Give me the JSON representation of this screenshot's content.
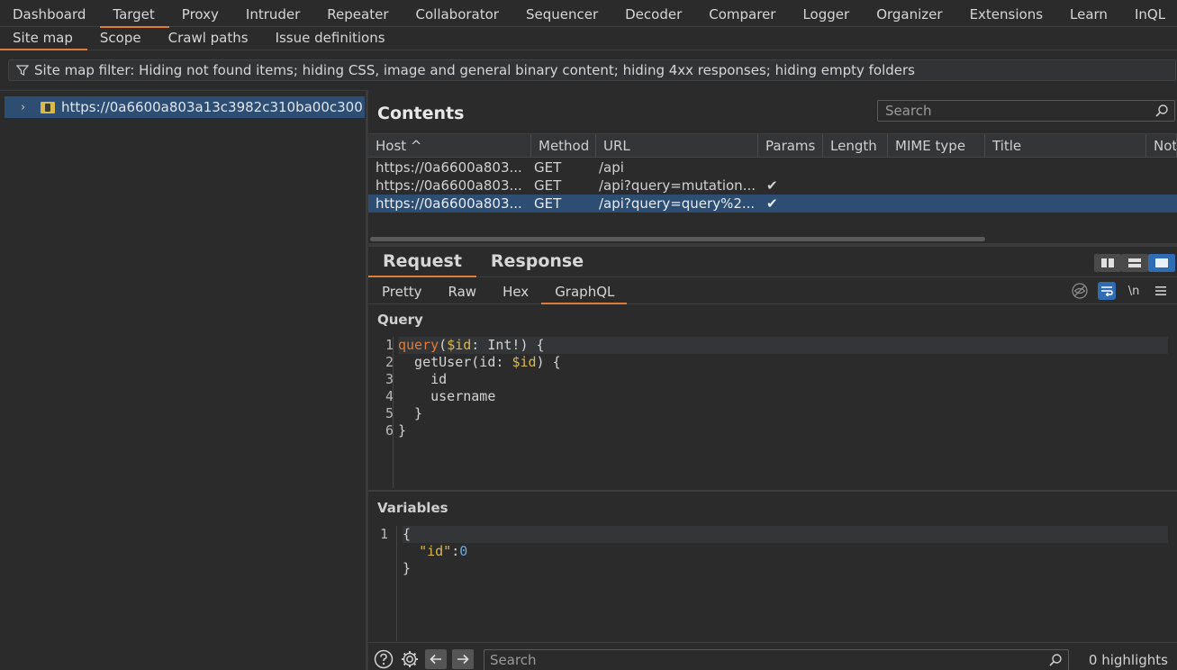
{
  "topnav": [
    "Dashboard",
    "Target",
    "Proxy",
    "Intruder",
    "Repeater",
    "Collaborator",
    "Sequencer",
    "Decoder",
    "Comparer",
    "Logger",
    "Organizer",
    "Extensions",
    "Learn",
    "InQL"
  ],
  "subnav": [
    "Site map",
    "Scope",
    "Crawl paths",
    "Issue definitions"
  ],
  "filter_text": "Site map filter: Hiding not found items;  hiding CSS, image and general binary content;  hiding 4xx responses;  hiding empty folders",
  "tree": {
    "host": "https://0a6600a803a13c3982c310ba00c300"
  },
  "contents": {
    "title": "Contents",
    "search_placeholder": "Search",
    "columns": [
      "Host ^",
      "Method",
      "URL",
      "Params",
      "Length",
      "MIME type",
      "Title",
      "Note"
    ],
    "rows": [
      {
        "host": "https://0a6600a803...",
        "method": "GET",
        "url": "/api",
        "params": "",
        "selected": false
      },
      {
        "host": "https://0a6600a803...",
        "method": "GET",
        "url": "/api?query=mutation...",
        "params": "✔",
        "selected": false
      },
      {
        "host": "https://0a6600a803...",
        "method": "GET",
        "url": "/api?query=query%2...",
        "params": "✔",
        "selected": true
      }
    ]
  },
  "rr_tabs": [
    "Request",
    "Response"
  ],
  "view_tabs": [
    "Pretty",
    "Raw",
    "Hex",
    "GraphQL"
  ],
  "newline_label": "\\n",
  "query": {
    "label": "Query",
    "gutter": [
      "1",
      "2",
      "3",
      "4",
      "5",
      "6"
    ]
  },
  "variables": {
    "label": "Variables",
    "gutter": [
      "1"
    ]
  },
  "bottom": {
    "search_placeholder": "Search",
    "highlights": "0 highlights"
  }
}
